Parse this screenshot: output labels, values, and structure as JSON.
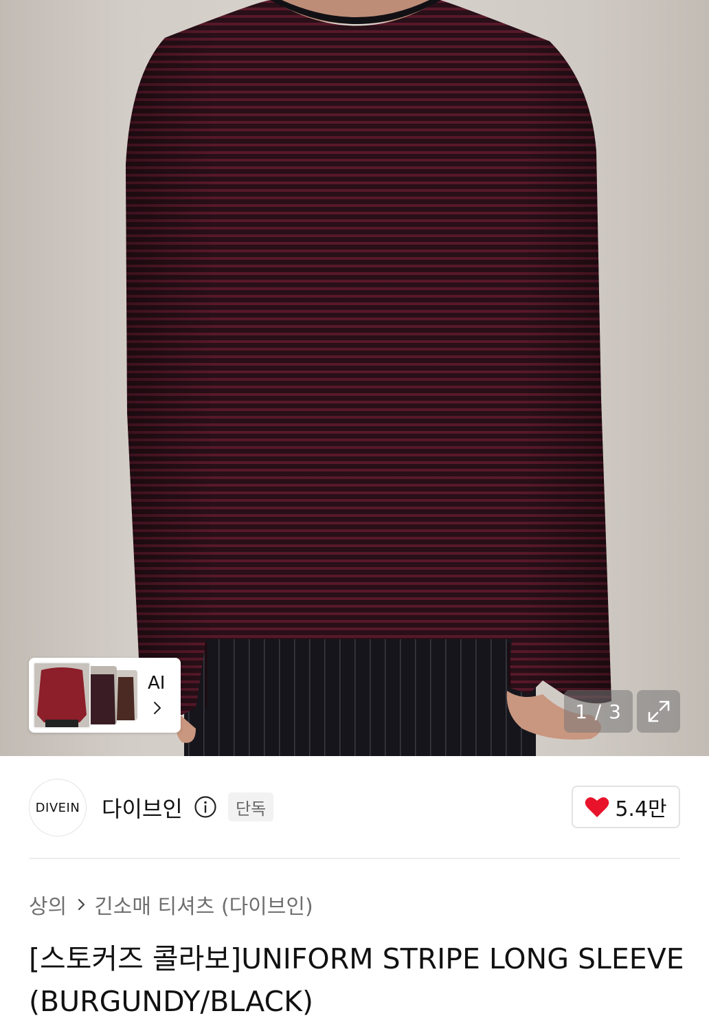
{
  "gallery": {
    "ai_label": "AI",
    "counter": "1 / 3",
    "icons": {
      "ai_arrow": "chevron-right-icon",
      "expand": "expand-icon"
    }
  },
  "brand": {
    "logo_text": "DIVEIN",
    "name": "다이브인",
    "badge": "단독",
    "likes": "5.4만",
    "icons": {
      "info": "info-icon",
      "like": "heart-icon"
    },
    "like_color": "#e8132b"
  },
  "breadcrumb": {
    "items": [
      "상의",
      "긴소매 티셔츠 (다이브인)"
    ],
    "separator_icon": "chevron-right-icon"
  },
  "product": {
    "title": "[스토커즈 콜라보]UNIFORM STRIPE LONG SLEEVE (BURGUNDY/BLACK)"
  }
}
